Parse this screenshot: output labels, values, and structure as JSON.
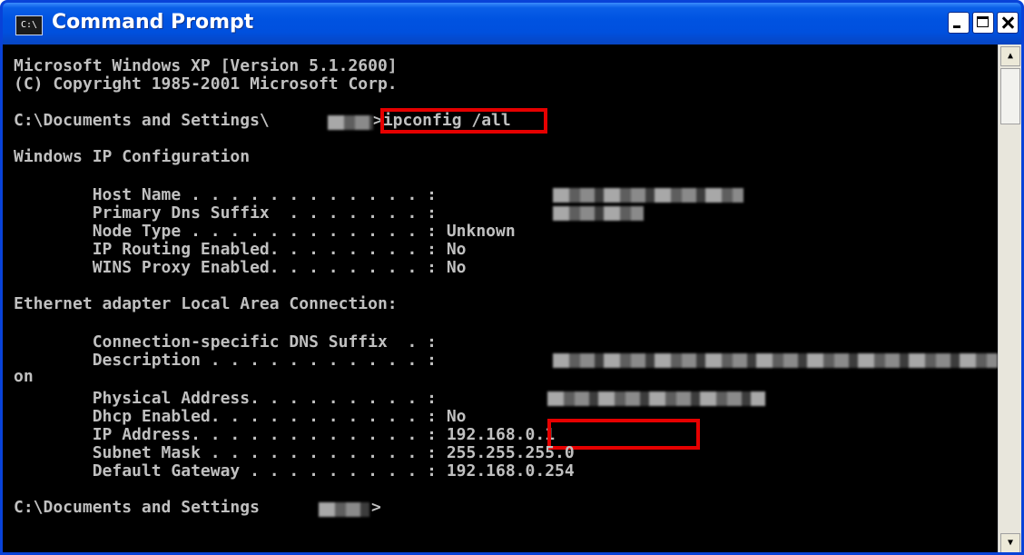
{
  "window": {
    "title": "Command Prompt",
    "icon_label": "C:\\"
  },
  "console": {
    "lines": [
      "Microsoft Windows XP [Version 5.1.2600]",
      "(C) Copyright 1985-2001 Microsoft Corp.",
      "C:\\Documents and Settings\\",
      ">ipconfig /all",
      "Windows IP Configuration",
      "        Host Name . . . . . . . . . . . . :",
      "        Primary Dns Suffix  . . . . . . . :",
      "        Node Type . . . . . . . . . . . . : Unknown",
      "        IP Routing Enabled. . . . . . . . : No",
      "        WINS Proxy Enabled. . . . . . . . : No",
      "Ethernet adapter Local Area Connection:",
      "        Connection-specific DNS Suffix  . :",
      "        Description . . . . . . . . . . . :",
      "on",
      "        Physical Address. . . . . . . . . :",
      "        Dhcp Enabled. . . . . . . . . . . : No",
      "        IP Address. . . . . . . . . . . . : 192.168.0.1",
      "        Subnet Mask . . . . . . . . . . . : 255.255.255.0",
      "        Default Gateway . . . . . . . . . : 192.168.0.254",
      "C:\\Documents and Settings",
      ">"
    ]
  },
  "colors": {
    "titlebar": "#0053e1",
    "console_bg": "#000000",
    "console_text": "#c0c0c0",
    "highlight": "#e60000"
  }
}
